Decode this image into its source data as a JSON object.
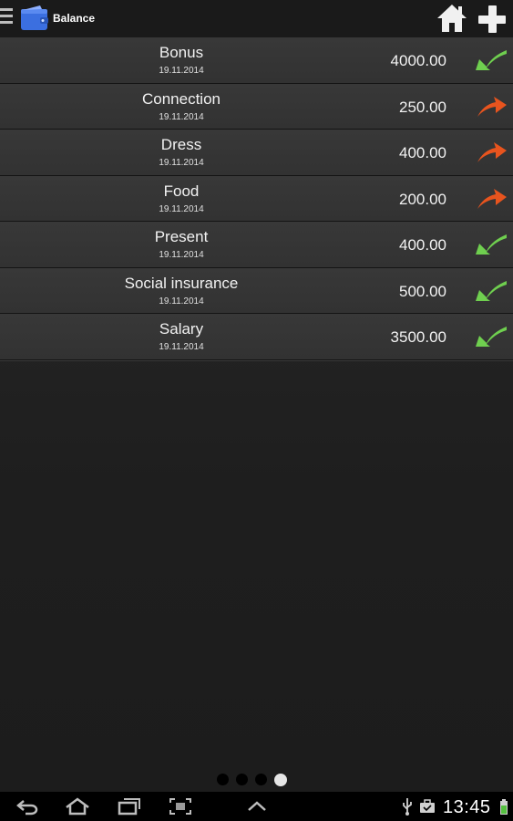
{
  "action_bar": {
    "title": "Balance",
    "icons": [
      "menu-icon",
      "wallet-icon",
      "home-icon",
      "add-icon"
    ]
  },
  "transactions": [
    {
      "name": "Bonus",
      "date": "19.11.2014",
      "amount": "4000.00",
      "direction": "income"
    },
    {
      "name": "Connection",
      "date": "19.11.2014",
      "amount": "250.00",
      "direction": "expense"
    },
    {
      "name": "Dress",
      "date": "19.11.2014",
      "amount": "400.00",
      "direction": "expense"
    },
    {
      "name": "Food",
      "date": "19.11.2014",
      "amount": "200.00",
      "direction": "expense"
    },
    {
      "name": "Present",
      "date": "19.11.2014",
      "amount": "400.00",
      "direction": "income"
    },
    {
      "name": "Social insurance",
      "date": "19.11.2014",
      "amount": "500.00",
      "direction": "income"
    },
    {
      "name": "Salary",
      "date": "19.11.2014",
      "amount": "3500.00",
      "direction": "income"
    }
  ],
  "colors": {
    "income": "#6fcf4f",
    "expense": "#e8541e",
    "wallet": "#3b6fe0"
  },
  "pager": {
    "pages": 4,
    "active": 4
  },
  "system_bar": {
    "time": "13:45",
    "icons": [
      "back-icon",
      "home-nav-icon",
      "recent-apps-icon",
      "screenshot-icon",
      "up-chevron-icon",
      "usb-icon",
      "briefcase-icon",
      "battery-icon"
    ]
  }
}
